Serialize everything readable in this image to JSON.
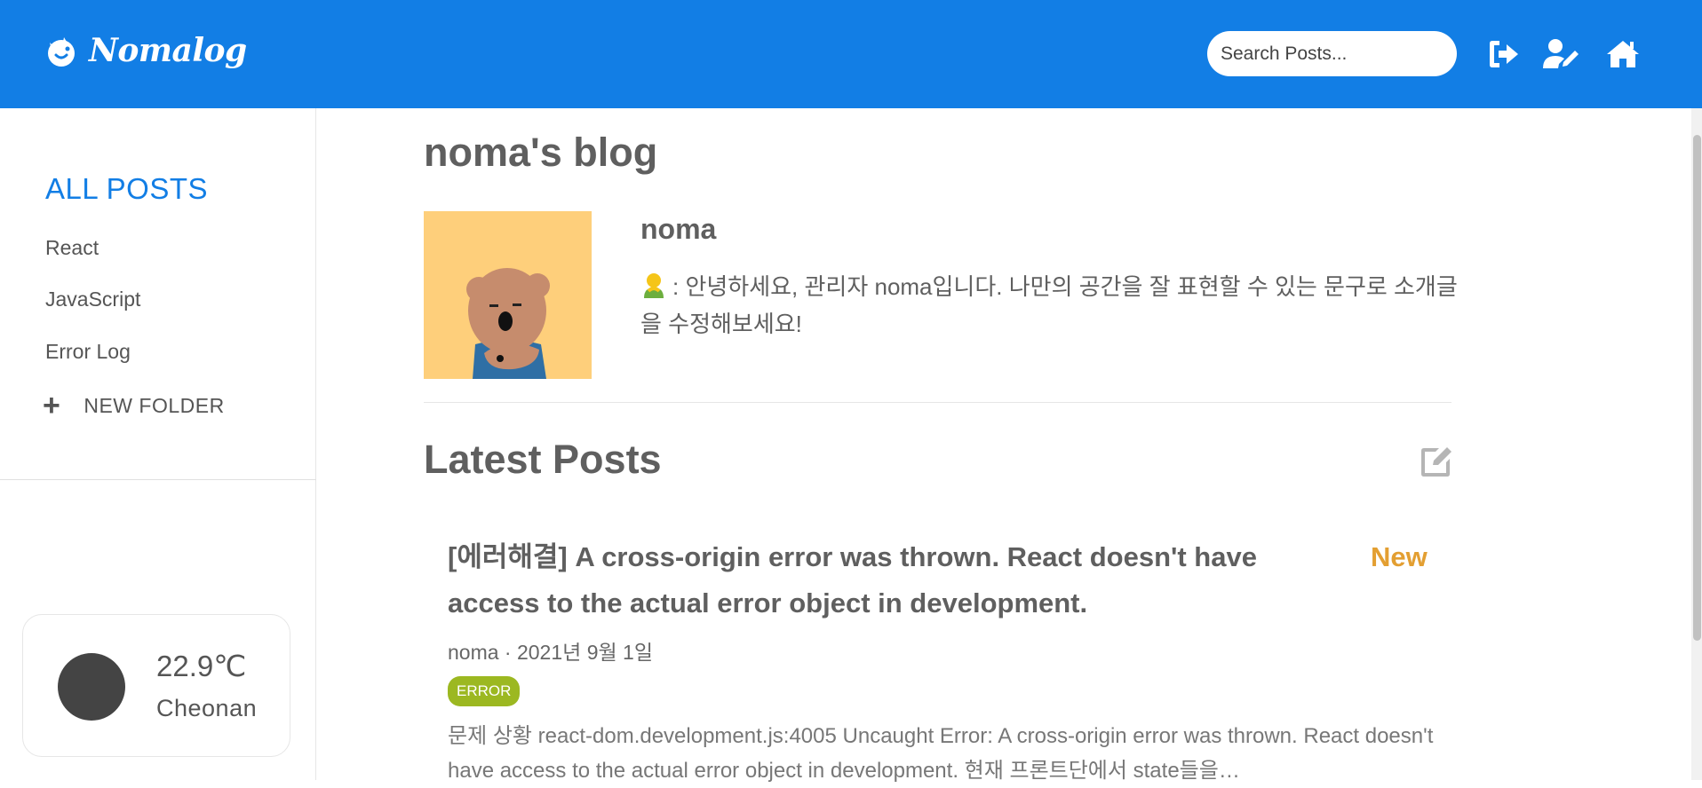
{
  "header": {
    "logo_text": "Nomalog",
    "search_placeholder": "Search Posts...",
    "icons": [
      "logout-icon",
      "user-edit-icon",
      "home-icon"
    ]
  },
  "sidebar": {
    "all_posts": "ALL POSTS",
    "folders": [
      "React",
      "JavaScript",
      "Error Log"
    ],
    "new_folder": "NEW FOLDER",
    "weather": {
      "temperature": "22.9℃",
      "city": "Cheonan"
    }
  },
  "main": {
    "blog_title": "noma's blog",
    "profile": {
      "name": "noma",
      "bio": ": 안녕하세요, 관리자 noma입니다. 나만의 공간을 잘 표현할 수 있는 문구로 소개글을 수정해보세요!"
    },
    "latest_title": "Latest Posts",
    "posts": [
      {
        "title": "[에러해결] A cross-origin error was thrown. React doesn't have access to the actual error object in development.",
        "badge": "New",
        "meta": "noma · 2021년 9월 1일",
        "tag": "ERROR",
        "excerpt": "문제 상황 react-dom.development.js:4005 Uncaught Error: A cross-origin error was thrown. React doesn't have access to the actual error object in development. 현재 프론트단에서 state들을…"
      }
    ]
  },
  "colors": {
    "primary": "#127ee5",
    "new_badge": "#e39f32",
    "tag": "#9cb821",
    "avatar_bg": "#fecf7b"
  }
}
